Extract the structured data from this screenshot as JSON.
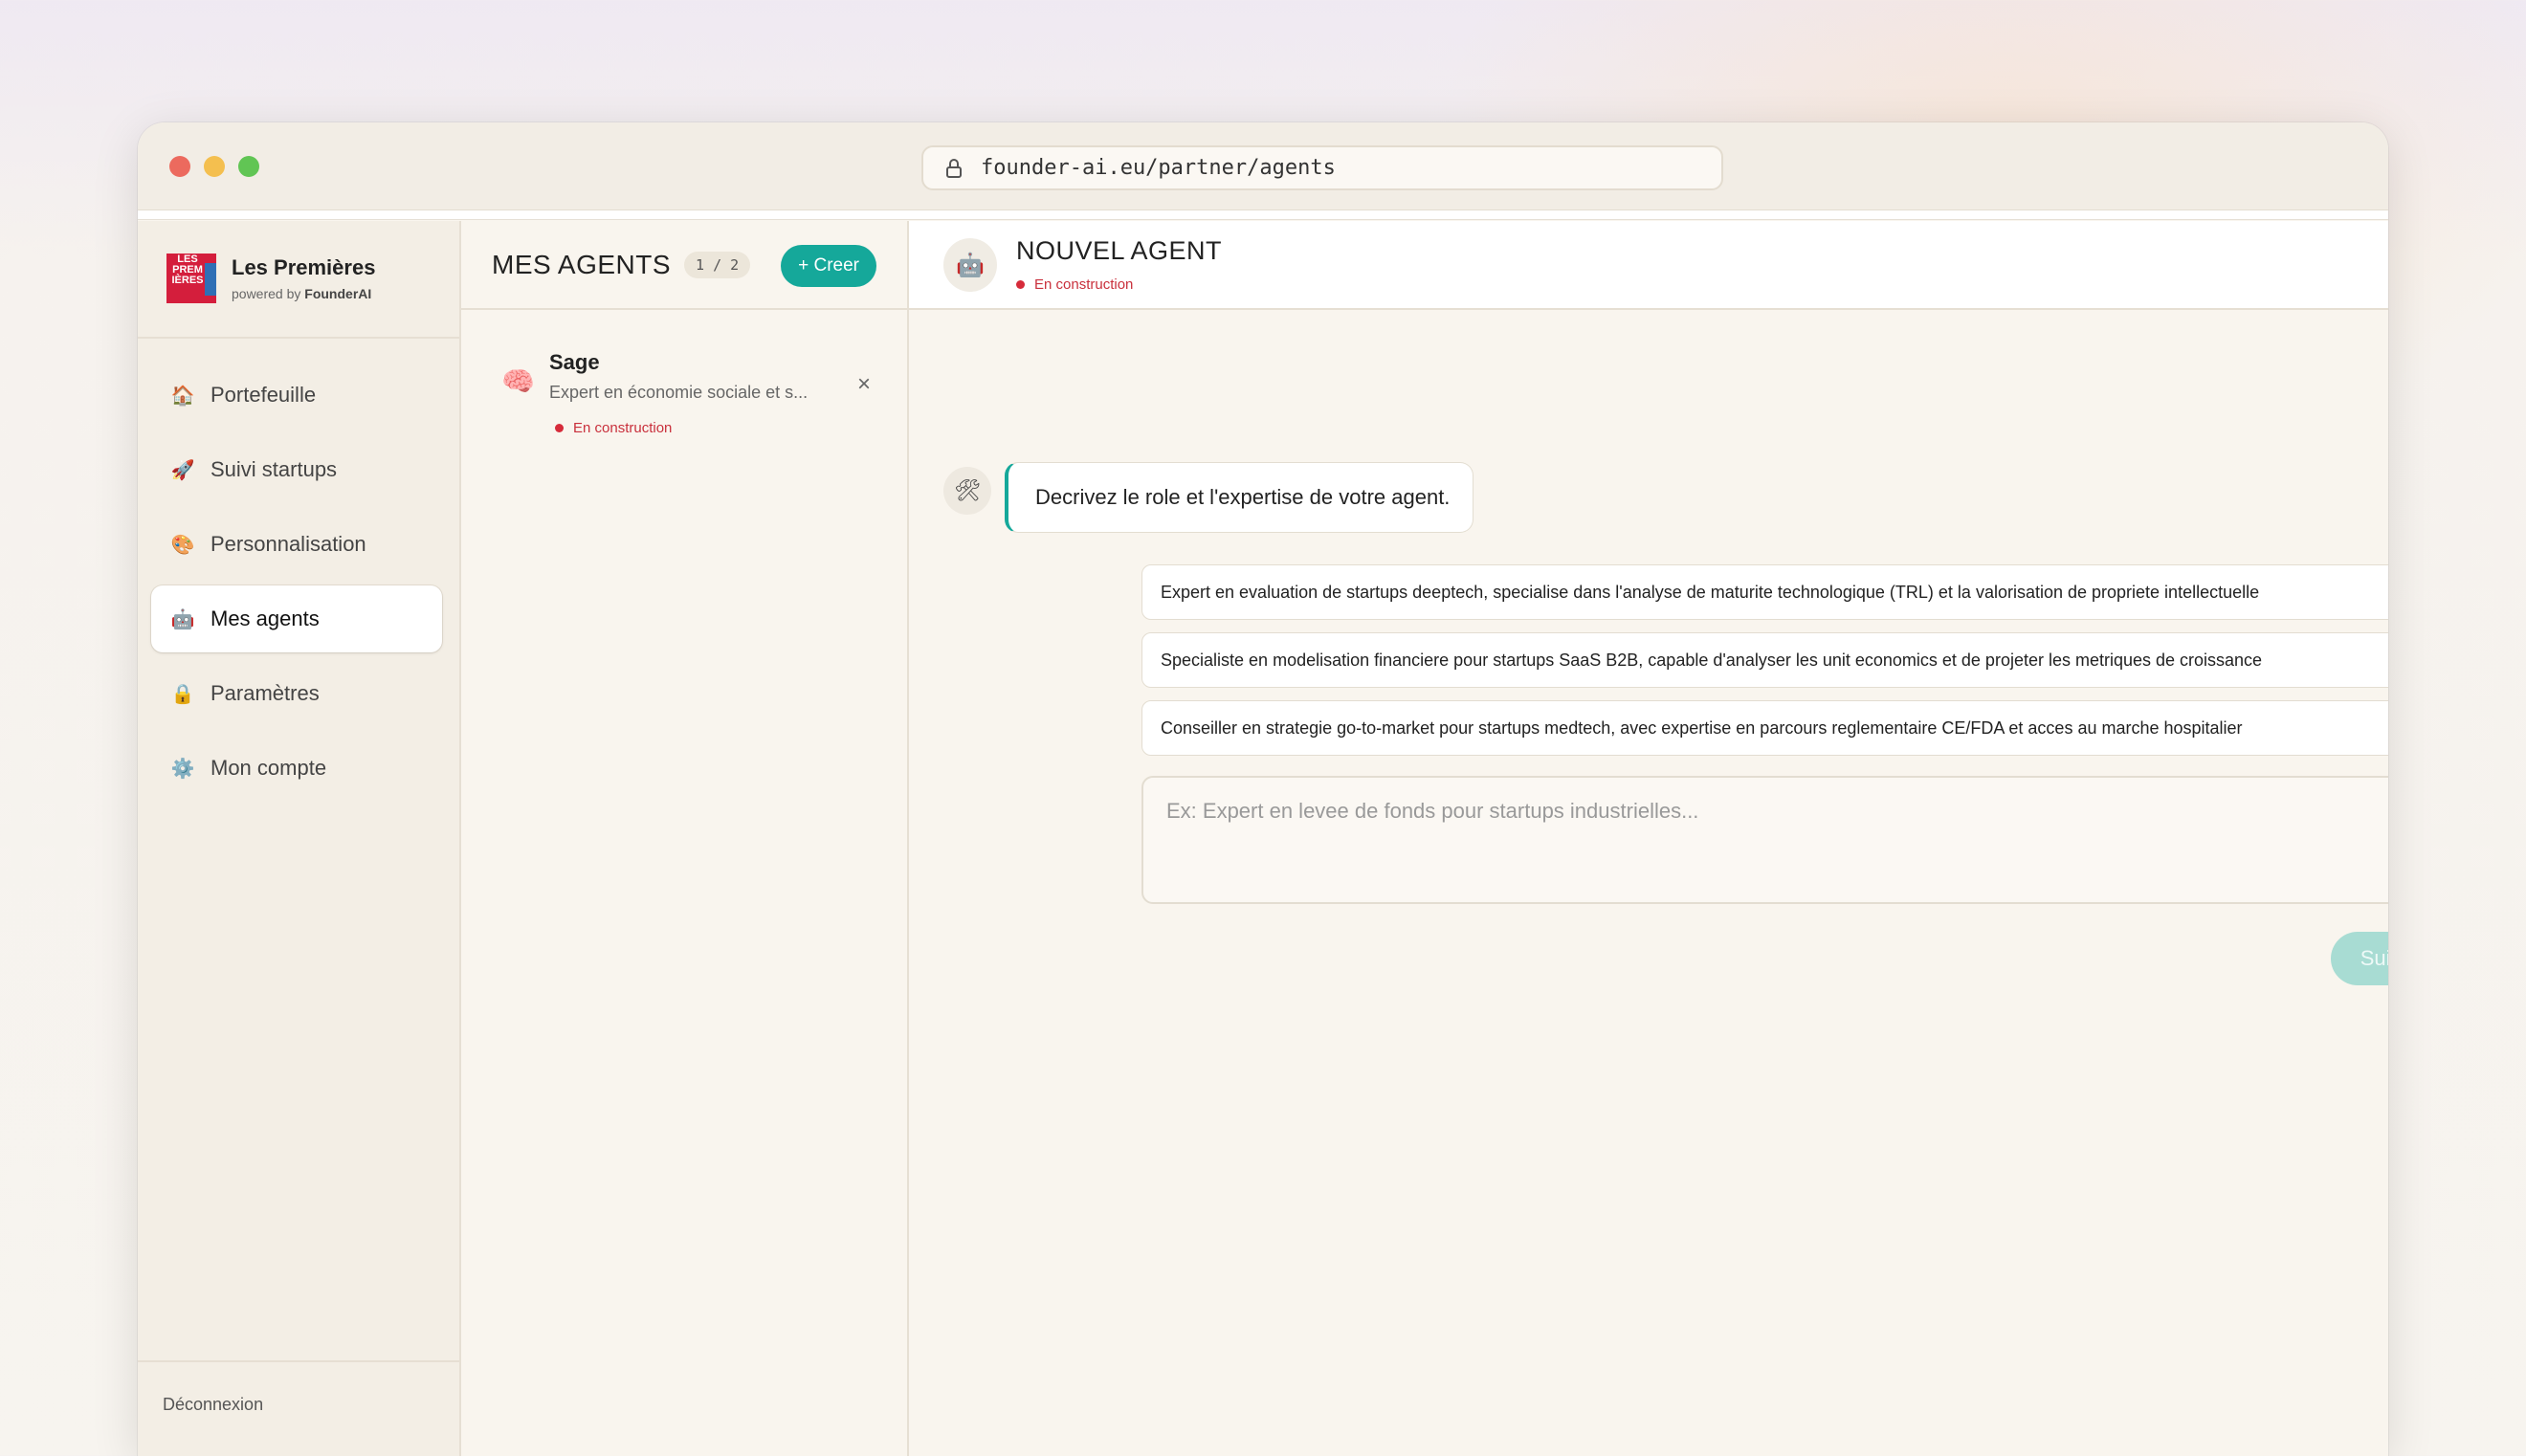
{
  "browser": {
    "url": "founder-ai.eu/partner/agents"
  },
  "brand": {
    "logo_text": "LES PREM IÈRES",
    "name": "Les Premières",
    "powered_prefix": "powered by ",
    "powered_name": "FounderAI"
  },
  "sidebar": {
    "items": [
      {
        "icon": "🏠",
        "label": "Portefeuille"
      },
      {
        "icon": "🚀",
        "label": "Suivi startups"
      },
      {
        "icon": "🎨",
        "label": "Personnalisation"
      },
      {
        "icon": "🤖",
        "label": "Mes agents"
      },
      {
        "icon": "🔒",
        "label": "Paramètres"
      },
      {
        "icon": "⚙️",
        "label": "Mon compte"
      }
    ],
    "logout": "Déconnexion"
  },
  "agents_panel": {
    "title": "MES AGENTS",
    "count": "1 / 2",
    "create_label": "+ Creer",
    "agents": [
      {
        "emoji": "🧠",
        "name": "Sage",
        "description": "Expert en économie sociale et s...",
        "status": "En construction"
      }
    ],
    "close_glyph": "×"
  },
  "main": {
    "avatar_icon": "🤖",
    "title": "NOUVEL AGENT",
    "status": "En construction",
    "tool_icon": "🛠",
    "prompt": "Decrivez le role et l'expertise de votre agent.",
    "suggestions": [
      "Expert en evaluation de startups deeptech, specialise dans l'analyse de maturite technologique (TRL) et la valorisation de propriete intellectuelle",
      "Specialiste en modelisation financiere pour startups SaaS B2B, capable d'analyser les unit economics et de projeter les metriques de croissance",
      "Conseiller en strategie go-to-market pour startups medtech, avec expertise en parcours reglementaire CE/FDA et acces au marche hospitalier"
    ],
    "input_placeholder": "Ex: Expert en levee de fonds pour startups industrielles...",
    "next_label": "Suivant →"
  },
  "colors": {
    "accent": "#15a89a",
    "status_red": "#d62b3a"
  }
}
